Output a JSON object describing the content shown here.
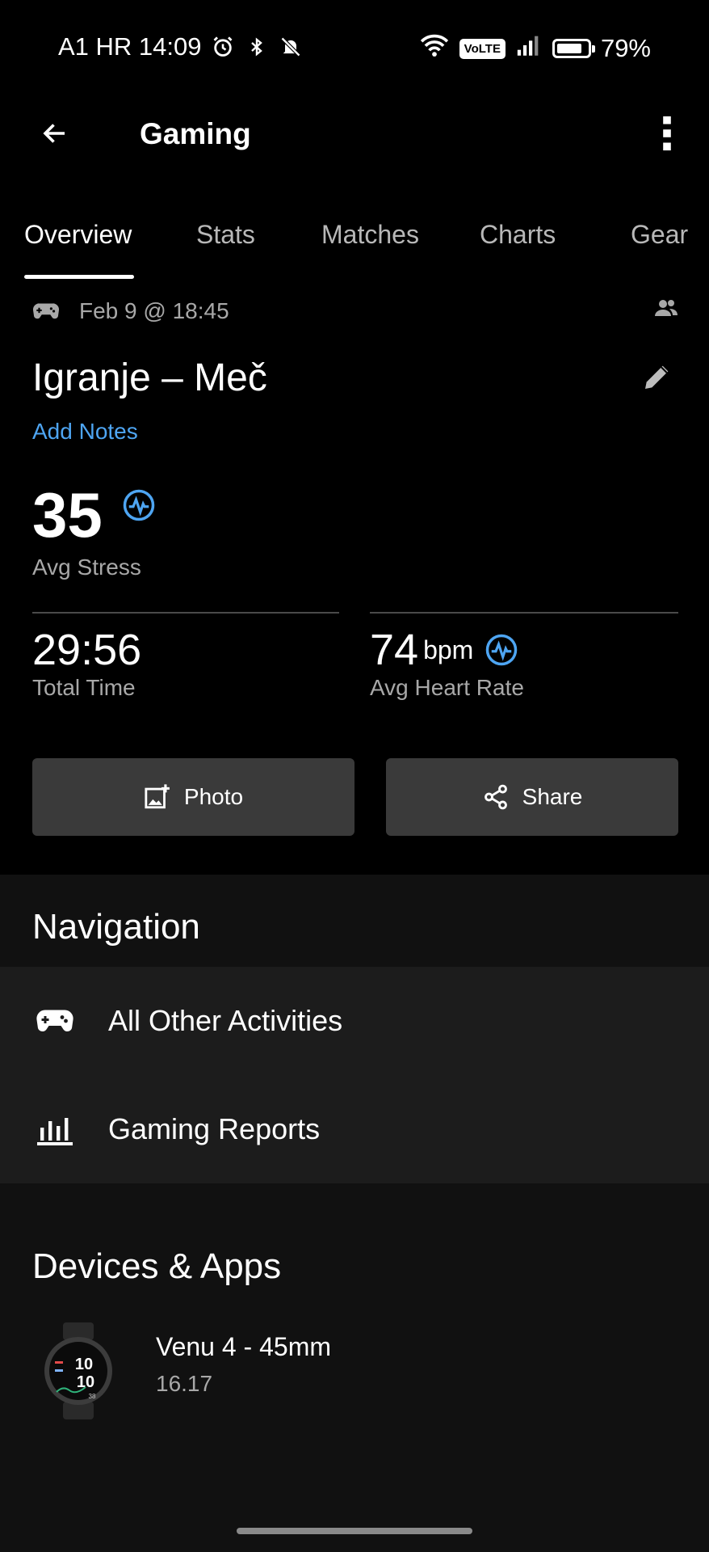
{
  "status_bar": {
    "carrier_time": "A1 HR 14:09",
    "battery": "79%",
    "battery_level": 0.79,
    "network": "VoLTE"
  },
  "app_bar": {
    "title": "Gaming"
  },
  "tabs": [
    {
      "label": "Overview",
      "active": true
    },
    {
      "label": "Stats",
      "active": false
    },
    {
      "label": "Matches",
      "active": false
    },
    {
      "label": "Charts",
      "active": false
    },
    {
      "label": "Gear",
      "active": false
    }
  ],
  "overview": {
    "date": "Feb 9 @ 18:45",
    "title": "Igranje – Meč",
    "add_notes": "Add Notes",
    "avg_stress": {
      "value": "35",
      "label": "Avg Stress"
    },
    "total_time": {
      "value": "29:56",
      "label": "Total Time"
    },
    "avg_heart_rate": {
      "value": "74",
      "unit": "bpm",
      "label": "Avg Heart Rate"
    },
    "photo_button": "Photo",
    "share_button": "Share"
  },
  "navigation": {
    "title": "Navigation",
    "items": [
      {
        "label": "All Other Activities",
        "icon": "gamepad-icon"
      },
      {
        "label": "Gaming Reports",
        "icon": "bar-chart-icon"
      }
    ]
  },
  "devices": {
    "title": "Devices & Apps",
    "device_name": "Venu 4 - 45mm",
    "device_version": "16.17",
    "watch_time_top": "10",
    "watch_time_bottom": "10",
    "watch_date": "38"
  },
  "colors": {
    "accent_blue": "#4ea5f2",
    "background": "#000000",
    "section_bg": "#111111",
    "button_bg": "#3a3a3a"
  }
}
